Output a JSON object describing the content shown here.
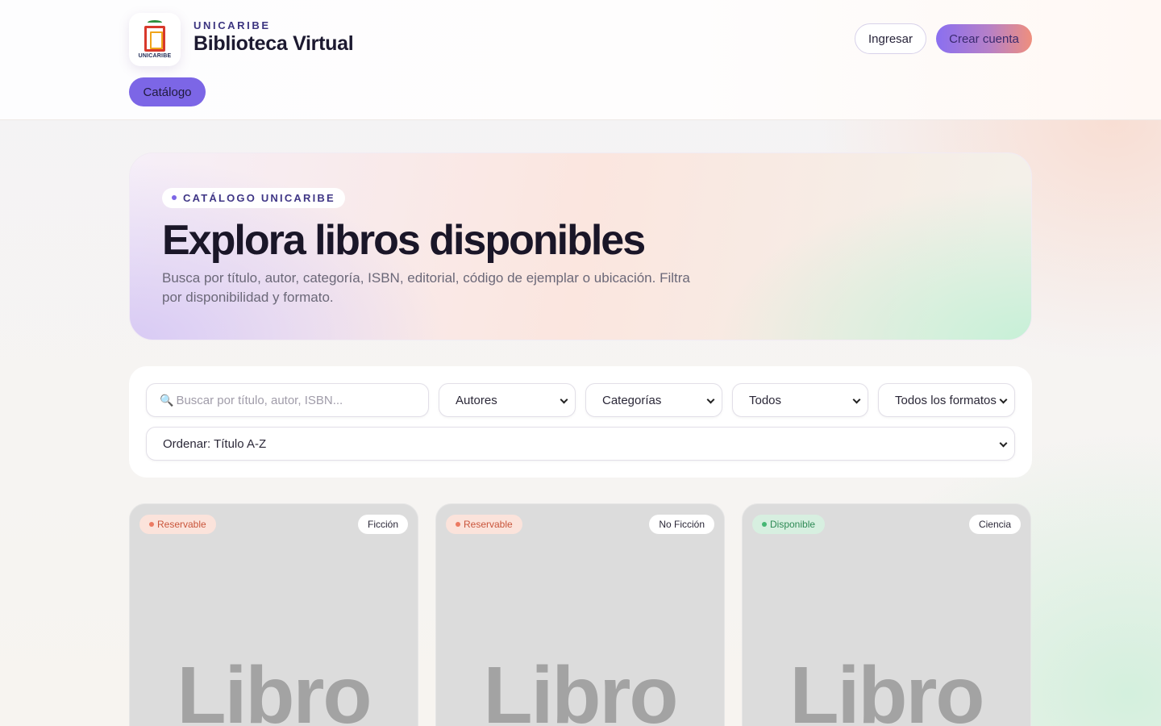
{
  "header": {
    "logo_text": "UNICARIBE",
    "kicker": "UNICARIBE",
    "title": "Biblioteca Virtual",
    "login_label": "Ingresar",
    "signup_label": "Crear cuenta",
    "nav": {
      "catalog_label": "Catálogo"
    }
  },
  "hero": {
    "tag": "CATÁLOGO UNICARIBE",
    "title": "Explora libros disponibles",
    "description": "Busca por título, autor, categoría, ISBN, editorial, código de ejemplar o ubicación. Filtra por disponibilidad y formato."
  },
  "filters": {
    "search_placeholder": "Buscar por título, autor, ISBN...",
    "search_icon": "🔍",
    "authors": "Autores",
    "categories": "Categorías",
    "availability": "Todos",
    "formats": "Todos los formatos",
    "sort": "Ordenar: Título A-Z"
  },
  "books": [
    {
      "status": "Reservable",
      "status_kind": "reservable",
      "category": "Ficción",
      "cover_text": "Libro"
    },
    {
      "status": "Reservable",
      "status_kind": "reservable",
      "category": "No Ficción",
      "cover_text": "Libro"
    },
    {
      "status": "Disponible",
      "status_kind": "disponible",
      "category": "Ciencia",
      "cover_text": "Libro"
    }
  ],
  "colors": {
    "accent": "#7c66e6",
    "reservable": "#ec7a62",
    "disponible": "#45b774"
  }
}
